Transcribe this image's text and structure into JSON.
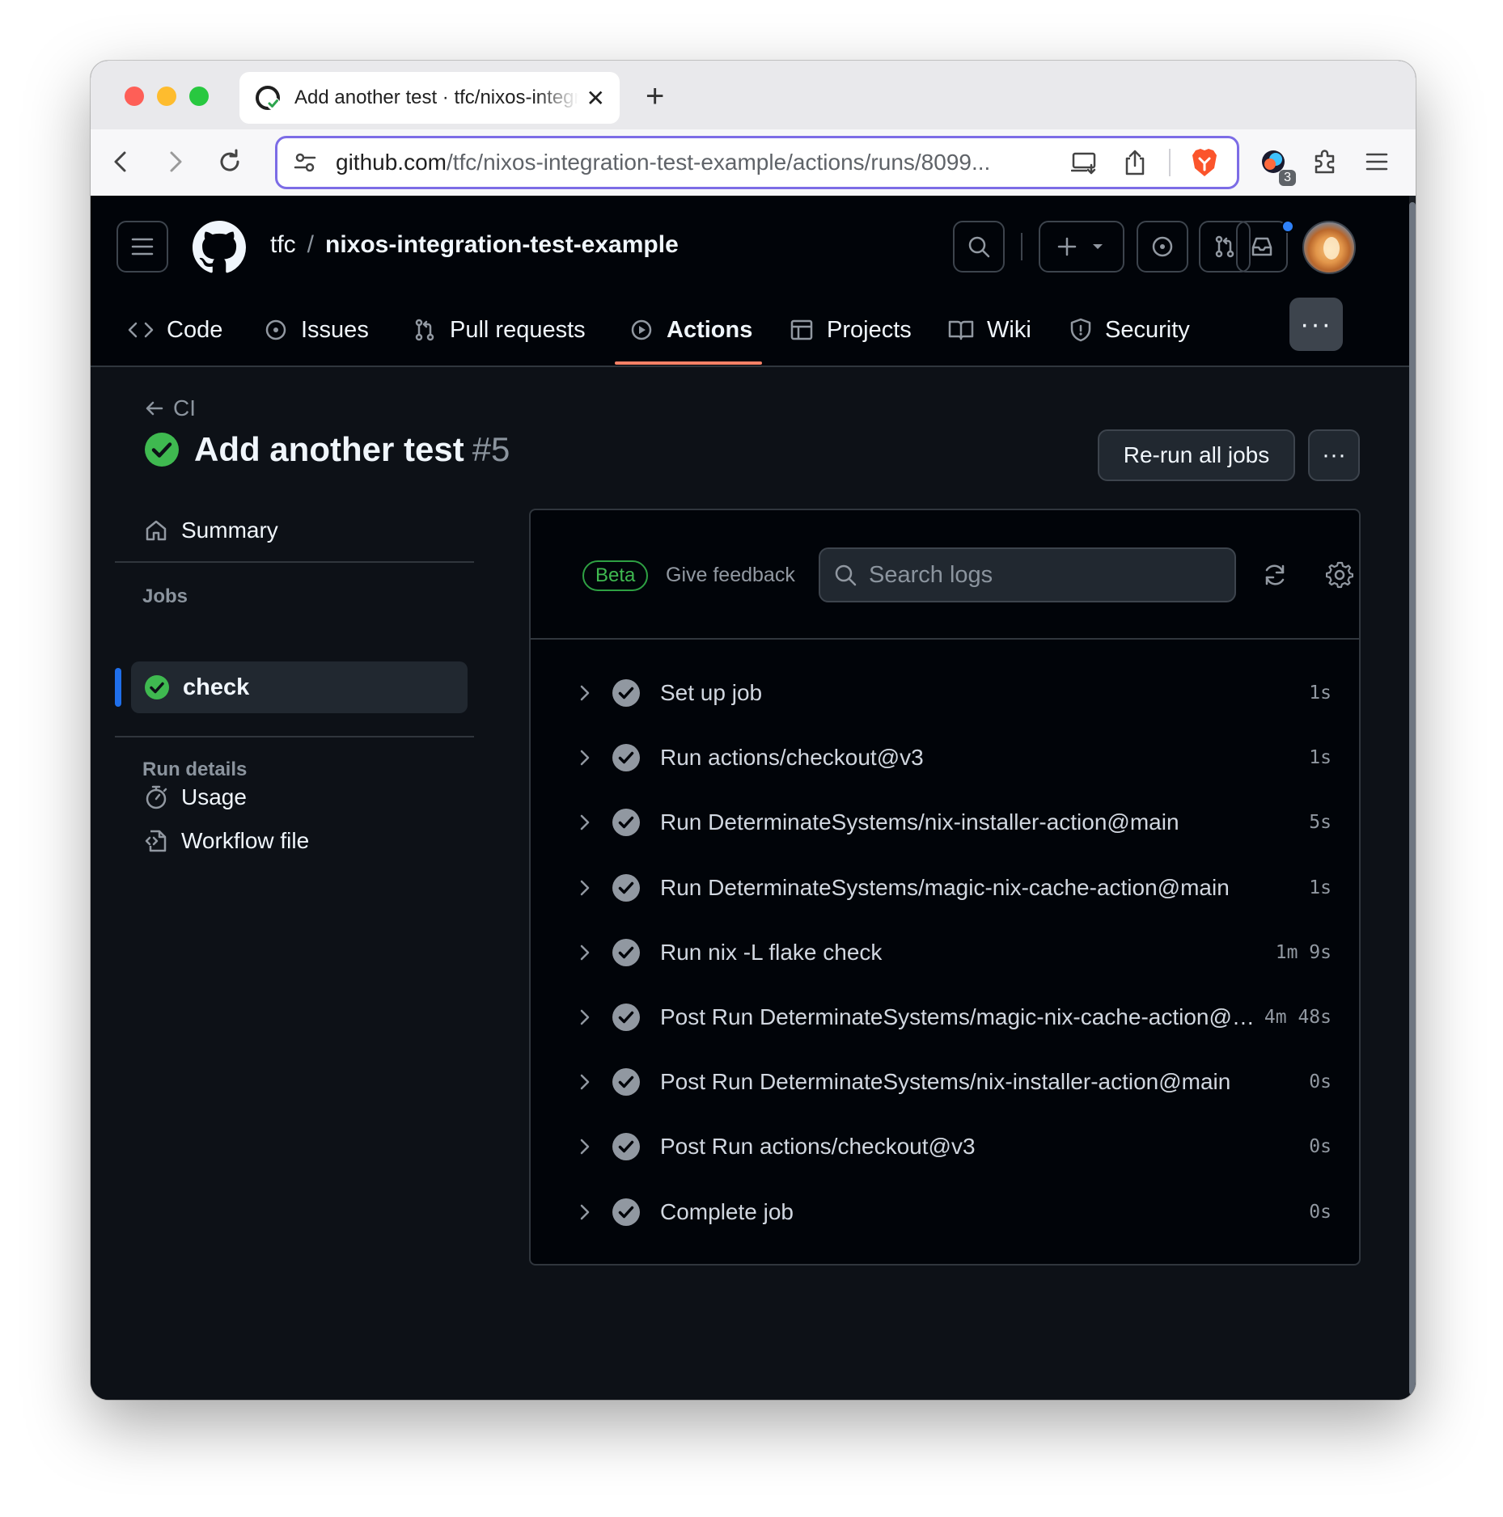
{
  "browser": {
    "tab_title": "Add another test · tfc/nixos-integration-test-example",
    "url_host": "github.com",
    "url_path": "/tfc/nixos-integration-test-example/actions/runs/8099...",
    "extension_badge": "3"
  },
  "header": {
    "owner": "tfc",
    "separator": "/",
    "repo": "nixos-integration-test-example"
  },
  "repo_nav": [
    {
      "label": "Code",
      "icon": "code-icon"
    },
    {
      "label": "Issues",
      "icon": "issue-icon"
    },
    {
      "label": "Pull requests",
      "icon": "pull-request-icon"
    },
    {
      "label": "Actions",
      "icon": "play-icon",
      "active": true
    },
    {
      "label": "Projects",
      "icon": "table-icon"
    },
    {
      "label": "Wiki",
      "icon": "book-icon"
    },
    {
      "label": "Security",
      "icon": "shield-icon"
    }
  ],
  "run": {
    "back_label": "CI",
    "title": "Add another test",
    "number": "#5",
    "rerun_label": "Re-run all jobs",
    "more_label": "···"
  },
  "sidebar": {
    "summary_label": "Summary",
    "jobs_heading": "Jobs",
    "active_job": "check",
    "run_details_heading": "Run details",
    "usage_label": "Usage",
    "workflow_file_label": "Workflow file"
  },
  "logs": {
    "beta_label": "Beta",
    "feedback_label": "Give feedback",
    "search_placeholder": "Search logs",
    "steps": [
      {
        "name": "Set up job",
        "duration": "1s"
      },
      {
        "name": "Run actions/checkout@v3",
        "duration": "1s"
      },
      {
        "name": "Run DeterminateSystems/nix-installer-action@main",
        "duration": "5s"
      },
      {
        "name": "Run DeterminateSystems/magic-nix-cache-action@main",
        "duration": "1s"
      },
      {
        "name": "Run nix -L flake check",
        "duration": "1m 9s"
      },
      {
        "name": "Post Run DeterminateSystems/magic-nix-cache-action@main",
        "duration": "4m 48s"
      },
      {
        "name": "Post Run DeterminateSystems/nix-installer-action@main",
        "duration": "0s"
      },
      {
        "name": "Post Run actions/checkout@v3",
        "duration": "0s"
      },
      {
        "name": "Complete job",
        "duration": "0s"
      }
    ]
  },
  "colors": {
    "success": "#3fb950",
    "accent_underline": "#f78166",
    "focus_ring": "#7c6ce6"
  }
}
